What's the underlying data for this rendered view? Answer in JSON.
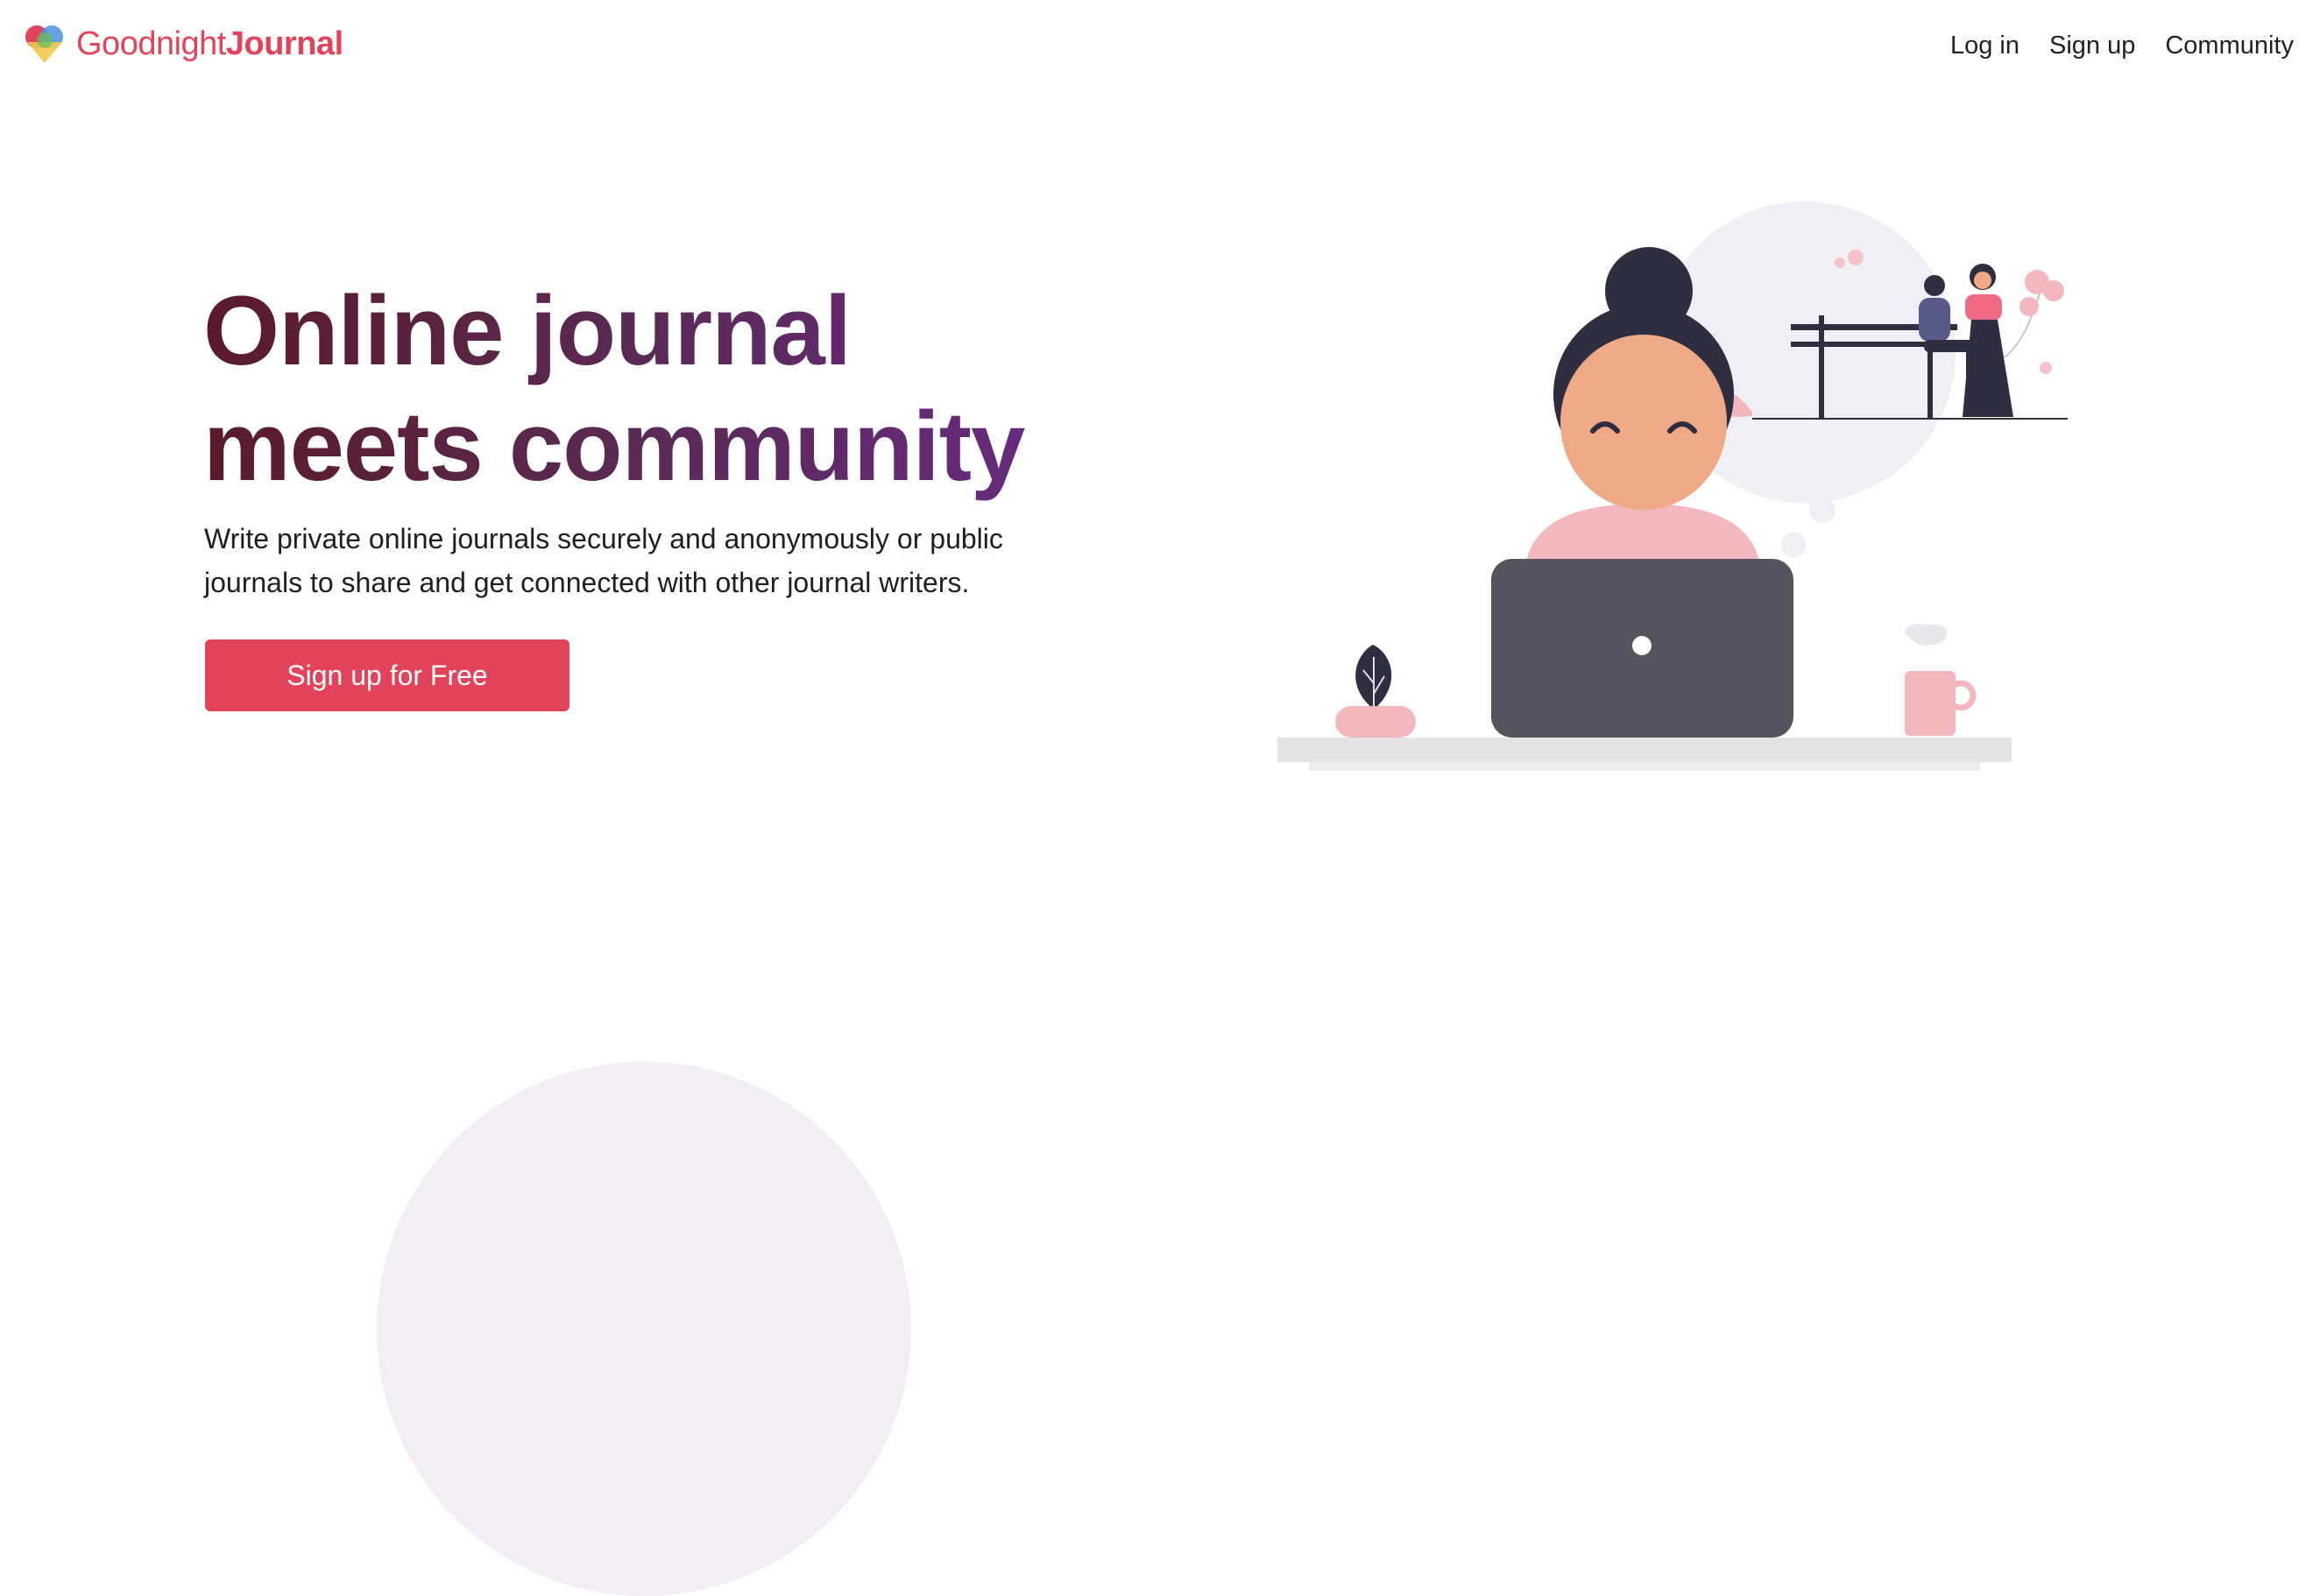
{
  "header": {
    "logo_word1": "Goodnight",
    "logo_word2": "Journal",
    "nav": [
      {
        "label": "Log in"
      },
      {
        "label": "Sign up"
      },
      {
        "label": "Community"
      }
    ]
  },
  "hero": {
    "title_line1": "Online journal",
    "title_line2": "meets community",
    "subtitle": "Write private online journals securely and anonymously or public journals to share and get connected with other journal writers.",
    "cta_label": "Sign up for Free"
  },
  "colors": {
    "brand": "#e2435a",
    "title_gradient_start": "#5a1a2a",
    "title_gradient_end": "#6b2b8a",
    "laptop": "#55535e",
    "skin": "#f0a986",
    "pink": "#f3b8bd",
    "hair": "#2f2e41"
  },
  "icons": {
    "logo": "heart-logo-icon"
  }
}
